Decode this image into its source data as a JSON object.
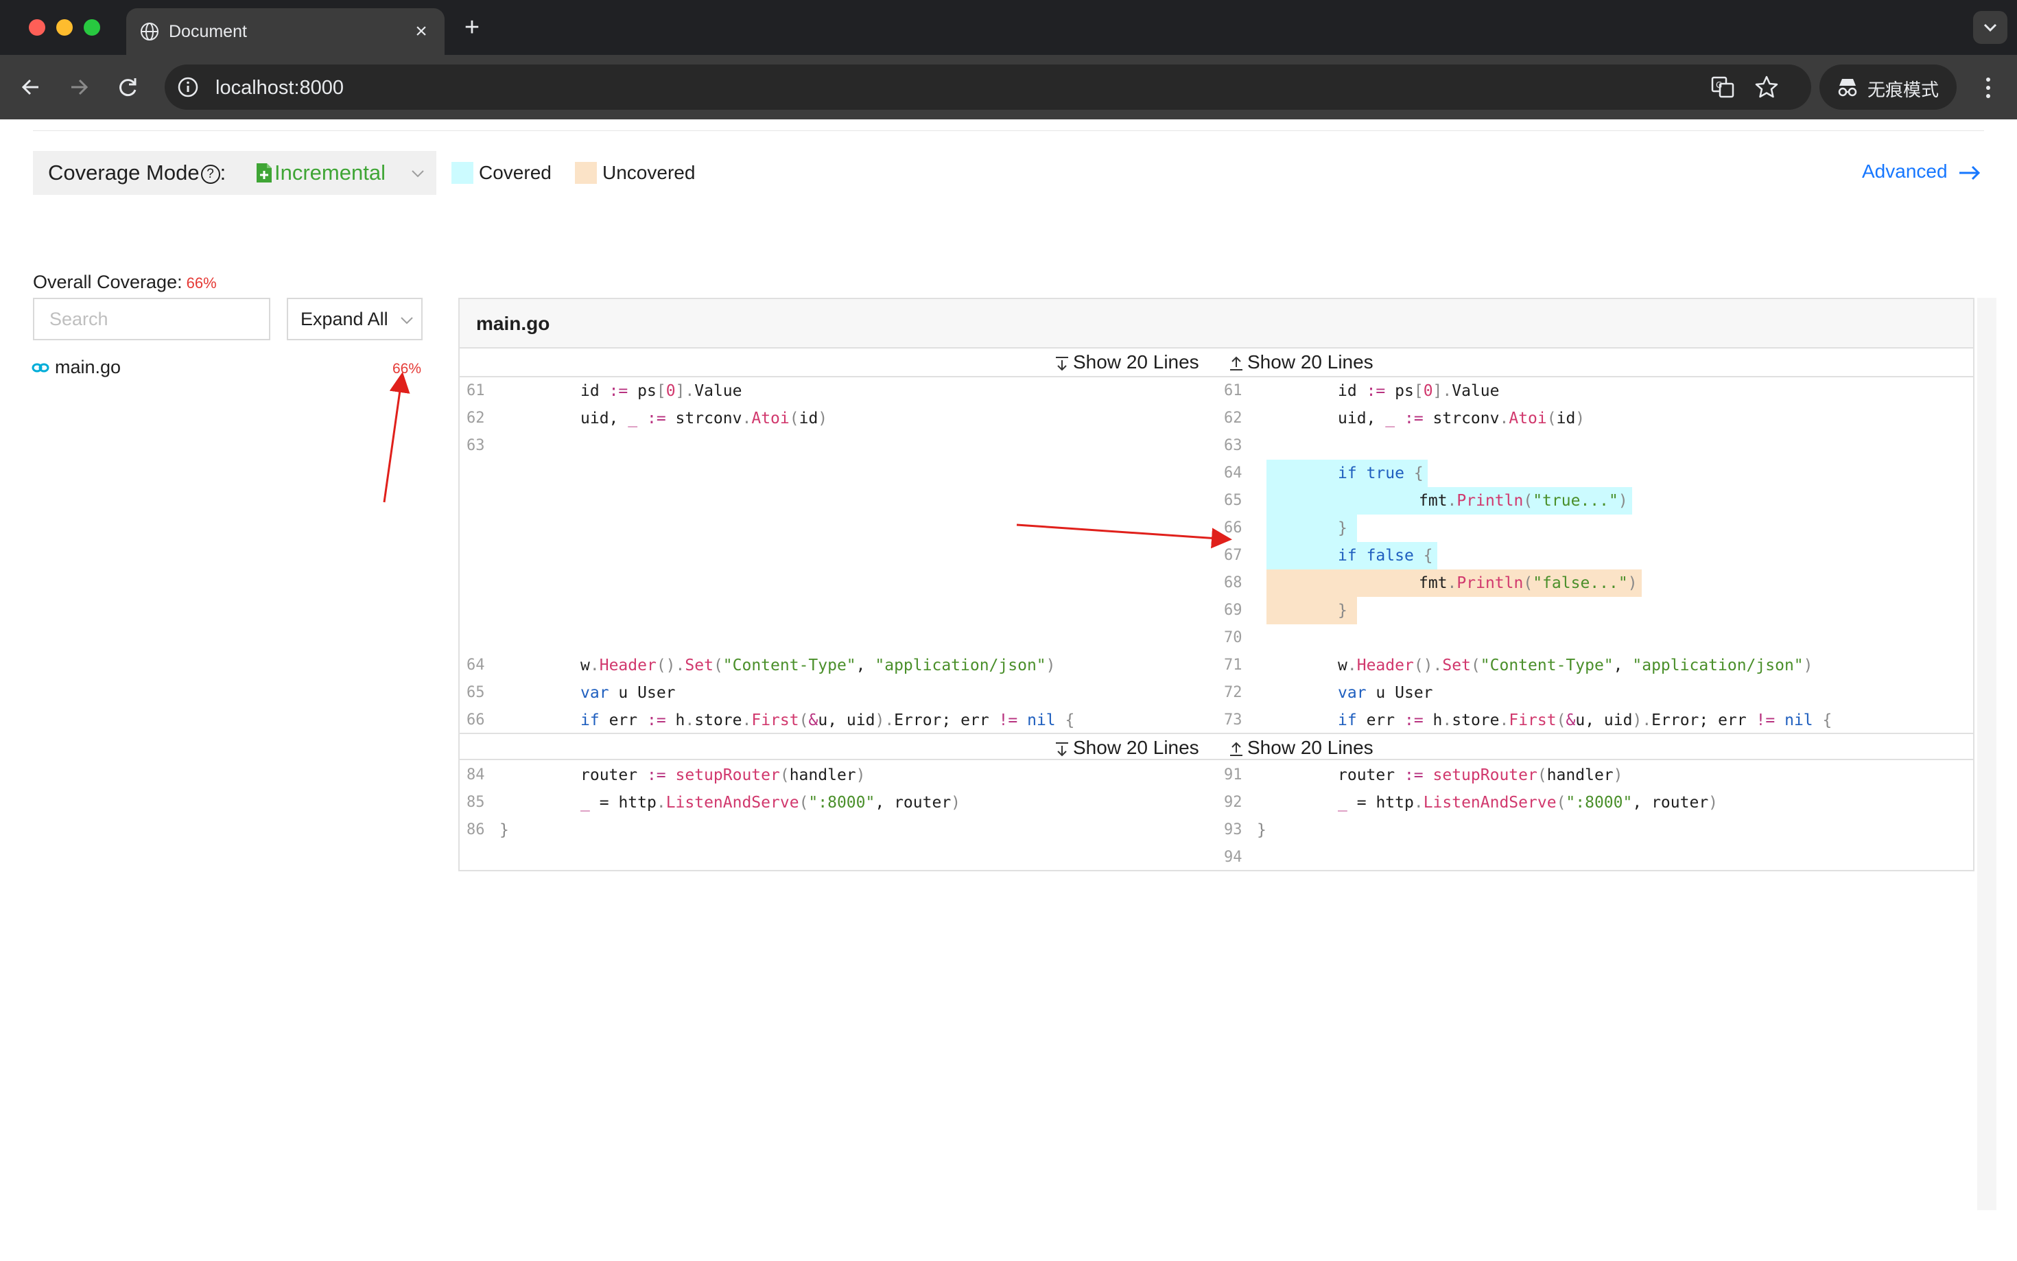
{
  "browser": {
    "tab_title": "Document",
    "url": "localhost:8000",
    "incognito_label": "无痕模式"
  },
  "toolbar": {
    "mode_label": "Coverage Mode",
    "mode_suffix": ":",
    "mode_help": "?",
    "mode_value": "Incremental",
    "legend_covered": "Covered",
    "legend_uncovered": "Uncovered",
    "advanced_label": "Advanced",
    "colors": {
      "covered": "#ccfbff",
      "uncovered": "#fbe3c7",
      "accent": "#1677ff",
      "incremental": "#3fa535",
      "bad": "#e53935"
    }
  },
  "sidebar": {
    "overall_label": "Overall Coverage:",
    "overall_value": "66%",
    "search_placeholder": "Search",
    "expand_label": "Expand All",
    "files": [
      {
        "name": "main.go",
        "coverage": "66%"
      }
    ]
  },
  "diff": {
    "file_title": "main.go",
    "show_down_label": "Show 20 Lines",
    "show_up_label": "Show 20 Lines",
    "left_hunk1": [
      {
        "n": "61",
        "t": "\tid := ps[0].Value"
      },
      {
        "n": "62",
        "t": "\tuid, _ := strconv.Atoi(id)"
      },
      {
        "n": "63",
        "t": ""
      },
      {
        "n": "64",
        "t": "\tw.Header().Set(\"Content-Type\", \"application/json\")"
      },
      {
        "n": "65",
        "t": "\tvar u User"
      },
      {
        "n": "66",
        "t": "\tif err := h.store.First(&u, uid).Error; err != nil {"
      }
    ],
    "right_hunk1": [
      {
        "n": "61",
        "t": "\tid := ps[0].Value"
      },
      {
        "n": "62",
        "t": "\tuid, _ := strconv.Atoi(id)"
      },
      {
        "n": "63",
        "t": ""
      },
      {
        "n": "64",
        "t": "\tif true {",
        "cov": "covered"
      },
      {
        "n": "65",
        "t": "\t\tfmt.Println(\"true...\")",
        "cov": "covered"
      },
      {
        "n": "66",
        "t": "\t}",
        "cov": "covered"
      },
      {
        "n": "67",
        "t": "\tif false {",
        "cov": "covered"
      },
      {
        "n": "68",
        "t": "\t\tfmt.Println(\"false...\")",
        "cov": "uncovered"
      },
      {
        "n": "69",
        "t": "\t}",
        "cov": "uncovered"
      },
      {
        "n": "70",
        "t": ""
      },
      {
        "n": "71",
        "t": "\tw.Header().Set(\"Content-Type\", \"application/json\")"
      },
      {
        "n": "72",
        "t": "\tvar u User"
      },
      {
        "n": "73",
        "t": "\tif err := h.store.First(&u, uid).Error; err != nil {"
      }
    ],
    "left_hunk2": [
      {
        "n": "84",
        "t": "\trouter := setupRouter(handler)"
      },
      {
        "n": "85",
        "t": "\t_ = http.ListenAndServe(\":8000\", router)"
      },
      {
        "n": "86",
        "t": "}"
      }
    ],
    "right_hunk2": [
      {
        "n": "91",
        "t": "\trouter := setupRouter(handler)"
      },
      {
        "n": "92",
        "t": "\t_ = http.ListenAndServe(\":8000\", router)"
      },
      {
        "n": "93",
        "t": "}"
      },
      {
        "n": "94",
        "t": ""
      }
    ]
  }
}
